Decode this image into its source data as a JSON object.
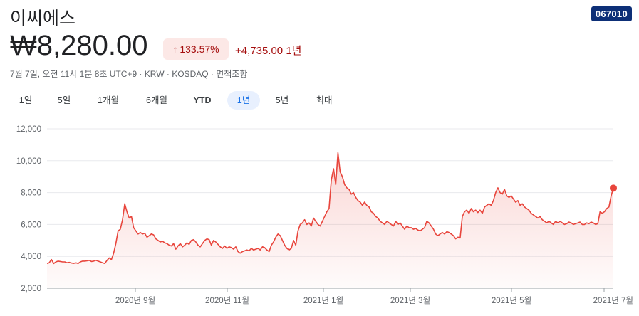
{
  "header": {
    "company_name": "이씨에스",
    "ticker": "067010",
    "price": "₩8,280.00",
    "change_arrow": "↑",
    "change_percent": "133.57%",
    "change_absolute": "+4,735.00 1년",
    "meta": "7월 7일, 오전 11시 1분 8초 UTC+9 · KRW · KOSDAQ · 면책조항"
  },
  "tabs": [
    {
      "label": "1일"
    },
    {
      "label": "5일"
    },
    {
      "label": "1개월"
    },
    {
      "label": "6개월"
    },
    {
      "label": "YTD"
    },
    {
      "label": "1년",
      "active": true
    },
    {
      "label": "5년"
    },
    {
      "label": "최대"
    }
  ],
  "colors": {
    "line": "#e8453c",
    "accent": "#1a73e8",
    "negative_text": "#a50e0e",
    "ticker_bg": "#0d2f77"
  },
  "chart_data": {
    "type": "area",
    "y_ticks": [
      "12,000",
      "10,000",
      "8,000",
      "6,000",
      "4,000",
      "2,000"
    ],
    "x_ticks": [
      "2020년 9월",
      "2020년 11월",
      "2021년 1월",
      "2021년 3월",
      "2021년 5월",
      "2021년 7월"
    ],
    "ylim": [
      2000,
      12000
    ],
    "grid": true,
    "series": [
      {
        "values": [
          3550,
          3600,
          3800,
          3550,
          3650,
          3700,
          3680,
          3650,
          3650,
          3600,
          3620,
          3580,
          3560,
          3600,
          3550,
          3650,
          3700,
          3700,
          3720,
          3750,
          3680,
          3700,
          3750,
          3700,
          3650,
          3600,
          3550,
          3750,
          3900,
          3800,
          4200,
          4800,
          5600,
          5700,
          6300,
          7300,
          6800,
          6400,
          6500,
          5800,
          5600,
          5400,
          5500,
          5400,
          5450,
          5200,
          5300,
          5400,
          5350,
          5100,
          5000,
          4900,
          4950,
          4850,
          4800,
          4700,
          4650,
          4800,
          4450,
          4650,
          4800,
          4600,
          4700,
          4850,
          4750,
          5000,
          5050,
          4900,
          4700,
          4600,
          4800,
          5000,
          5100,
          5050,
          4700,
          5000,
          4900,
          4750,
          4600,
          4500,
          4650,
          4500,
          4600,
          4550,
          4450,
          4600,
          4300,
          4200,
          4300,
          4350,
          4400,
          4350,
          4500,
          4400,
          4450,
          4500,
          4400,
          4600,
          4550,
          4400,
          4300,
          4700,
          4900,
          5200,
          5400,
          5300,
          5000,
          4700,
          4500,
          4400,
          4500,
          5000,
          4700,
          5600,
          6000,
          6100,
          6300,
          6000,
          6100,
          5900,
          6400,
          6200,
          6000,
          5900,
          6200,
          6500,
          6800,
          7000,
          8800,
          9500,
          8500,
          10500,
          9300,
          9000,
          8500,
          8300,
          8200,
          7900,
          8000,
          7700,
          7500,
          7400,
          7200,
          7400,
          7200,
          7100,
          6800,
          6700,
          6500,
          6400,
          6200,
          6100,
          6000,
          6200,
          6100,
          6000,
          5900,
          6200,
          6000,
          6100,
          5900,
          5700,
          5900,
          5800,
          5800,
          5700,
          5750,
          5650,
          5600,
          5700,
          5800,
          6200,
          6100,
          5900,
          5700,
          5400,
          5300,
          5400,
          5500,
          5400,
          5550,
          5500,
          5400,
          5300,
          5100,
          5200,
          5150,
          6500,
          6800,
          6900,
          6700,
          7000,
          6800,
          6900,
          6750,
          6900,
          6700,
          7100,
          7200,
          7300,
          7200,
          7500,
          8000,
          8300,
          8000,
          7900,
          8200,
          7800,
          7700,
          7800,
          7600,
          7400,
          7500,
          7200,
          7300,
          7100,
          7000,
          6900,
          6700,
          6600,
          6500,
          6400,
          6500,
          6300,
          6200,
          6100,
          6200,
          6100,
          6000,
          6200,
          6100,
          6200,
          6100,
          6000,
          6050,
          6150,
          6100,
          6000,
          6050,
          6100,
          6150,
          6000,
          6000,
          6100,
          6050,
          6150,
          6100,
          6000,
          6050,
          6800,
          6700,
          6800,
          7000,
          7100,
          7800,
          8280
        ]
      }
    ],
    "last_value": 8280
  }
}
